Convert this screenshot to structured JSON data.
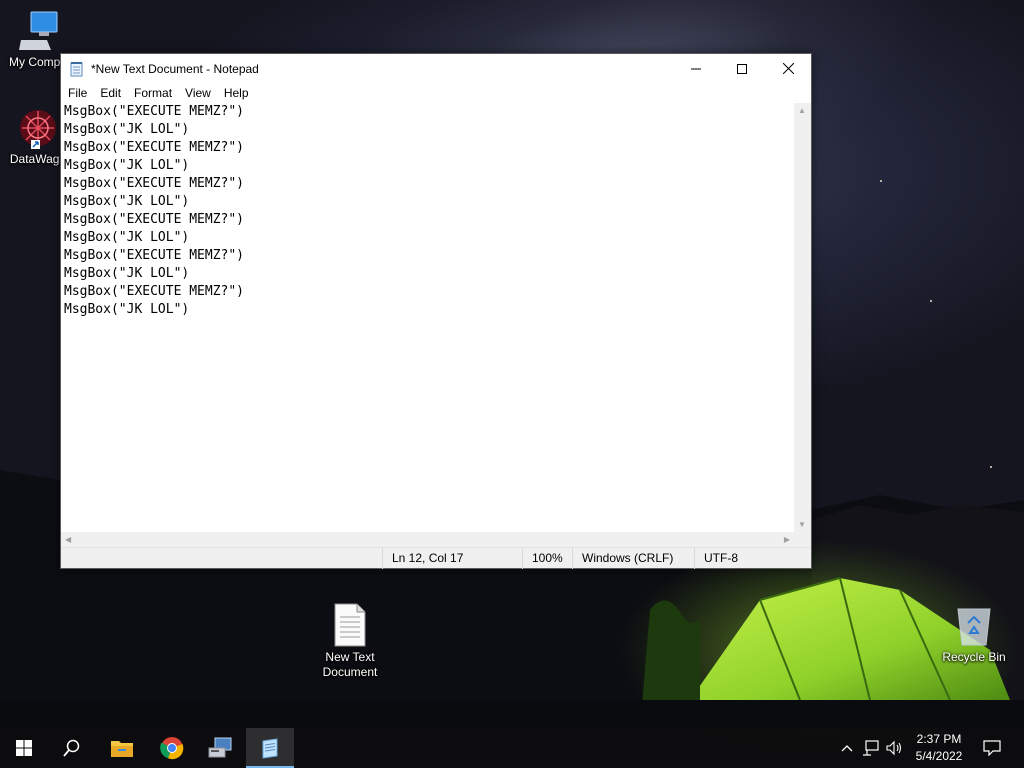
{
  "desktop": {
    "icons": [
      {
        "label": "My Compu"
      },
      {
        "label": "DataWago"
      },
      {
        "label": "New Text Document"
      },
      {
        "label": "Recycle Bin"
      }
    ]
  },
  "notepad": {
    "title": "*New Text Document - Notepad",
    "menu": [
      "File",
      "Edit",
      "Format",
      "View",
      "Help"
    ],
    "content": "MsgBox(\"EXECUTE MEMZ?\")\nMsgBox(\"JK LOL\")\nMsgBox(\"EXECUTE MEMZ?\")\nMsgBox(\"JK LOL\")\nMsgBox(\"EXECUTE MEMZ?\")\nMsgBox(\"JK LOL\")\nMsgBox(\"EXECUTE MEMZ?\")\nMsgBox(\"JK LOL\")\nMsgBox(\"EXECUTE MEMZ?\")\nMsgBox(\"JK LOL\")\nMsgBox(\"EXECUTE MEMZ?\")\nMsgBox(\"JK LOL\")",
    "status": {
      "position": "Ln 12, Col 17",
      "zoom": "100%",
      "line_ending": "Windows (CRLF)",
      "encoding": "UTF-8"
    },
    "window_controls": {
      "minimize": "minimize-icon",
      "maximize": "maximize-icon",
      "close": "close-icon"
    }
  },
  "taskbar": {
    "pinned": [
      "start-icon",
      "search-icon",
      "file-explorer-icon",
      "chrome-icon",
      "network-computer-icon",
      "notepad-icon"
    ],
    "active": "notepad-icon",
    "tray": [
      "chevron-up-icon",
      "network-icon",
      "volume-icon"
    ],
    "clock": {
      "time": "2:37 PM",
      "date": "5/4/2022"
    },
    "notification": "notification-icon"
  },
  "colors": {
    "taskbar_accent": "#76b9ed",
    "tent_green": "#8fd12a"
  }
}
